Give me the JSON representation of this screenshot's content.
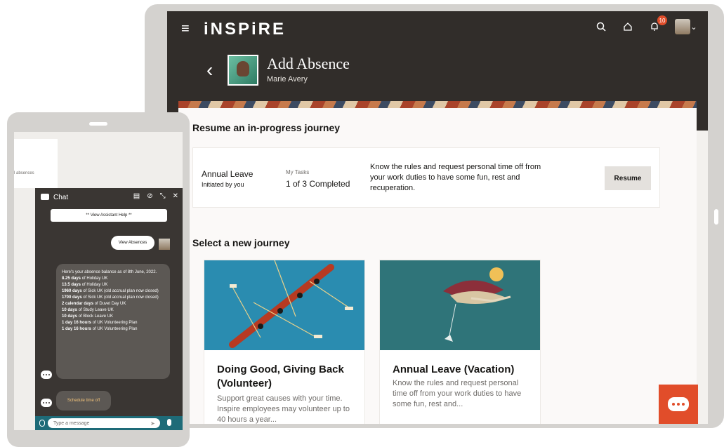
{
  "app": {
    "logo": "iNSPiRE",
    "notification_count": "10",
    "page_title": "Add Absence",
    "page_subtitle": "Marie Avery"
  },
  "resume_section": {
    "title": "Resume an in-progress journey",
    "card": {
      "title": "Annual Leave",
      "subtitle": "Initiated by you",
      "tasks_label": "My Tasks",
      "tasks_value": "1 of 3 Completed",
      "description": "Know the rules and request personal time off from your work duties to have some fun, rest and recuperation.",
      "button_label": "Resume"
    }
  },
  "journey_section": {
    "title": "Select a new journey",
    "cards": [
      {
        "title": "Doing Good, Giving Back (Volunteer)",
        "description": "Support great causes with your time. Inspire employees may volunteer up to 40 hours a year..."
      },
      {
        "title": "Annual Leave (Vacation)",
        "description": "Know the rules and request personal time off from your work duties to have some fun, rest and..."
      }
    ]
  },
  "phone": {
    "background_text": "l absences",
    "chat": {
      "title": "Chat",
      "help_button": "** View Assistant Help **",
      "user_message": "View Absences",
      "bot_intro": "Here's your absence balance as of 8th June, 2022.",
      "balances": [
        {
          "amount": "8.25 days",
          "rest": " of Holiday UK"
        },
        {
          "amount": "13.5 days",
          "rest": " of Holiday UK"
        },
        {
          "amount": "1960 days",
          "rest": " of Sick UK (old accrual plan now closed)"
        },
        {
          "amount": "1700 days",
          "rest": " of Sick UK (old accrual plan now closed)"
        },
        {
          "amount": "2 calendar days",
          "rest": " of Duvet Day UK"
        },
        {
          "amount": "10 days",
          "rest": " of Study Leave UK"
        },
        {
          "amount": "10 days",
          "rest": " of Block Leave UK"
        },
        {
          "amount": "1 day 16 hours",
          "rest": " of UK Volunteering Plan"
        },
        {
          "amount": "1 day 16 hours",
          "rest": " of UK Volunteering Plan"
        }
      ],
      "schedule_button": "Schedule time off",
      "input_placeholder": "Type a message"
    }
  },
  "colors": {
    "header": "#312d2a",
    "accent": "#e14d2a",
    "chat_bg": "#3a3633",
    "chat_bar": "#1e6b78"
  },
  "icons": [
    "hamburger-icon",
    "search-icon",
    "home-icon",
    "bell-icon",
    "back-chevron-icon",
    "chat-icon",
    "attachment-icon",
    "send-icon",
    "mic-icon"
  ]
}
